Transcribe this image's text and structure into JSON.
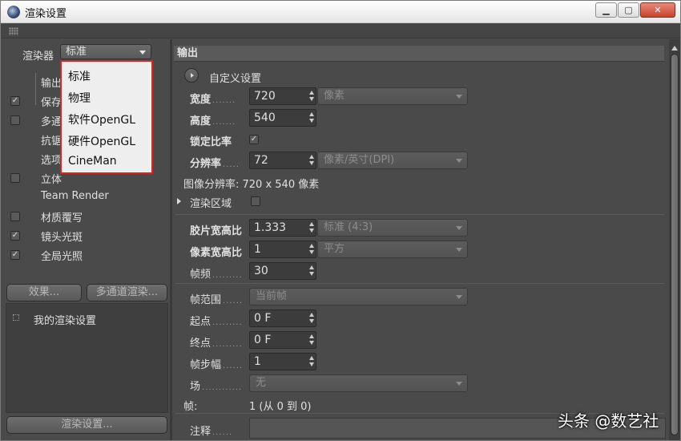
{
  "window": {
    "title": "渲染设置",
    "minimize": "▁",
    "restore": "▢",
    "close": "✕"
  },
  "left": {
    "renderer_label": "渲染器",
    "renderer_value": "标准",
    "nav_items": [
      {
        "label": "输出",
        "checked": null
      },
      {
        "label": "保存",
        "checked": true
      },
      {
        "label": "多通道",
        "checked": false
      },
      {
        "label": "抗锯齿",
        "checked": null
      },
      {
        "label": "选项",
        "checked": null
      },
      {
        "label": "立体",
        "checked": false
      },
      {
        "label": "Team Render",
        "checked": null
      },
      {
        "label": "材质覆写",
        "checked": false
      },
      {
        "label": "镜头光斑",
        "checked": true
      },
      {
        "label": "全局光照",
        "checked": true
      }
    ],
    "effects_button": "效果...",
    "multipass_button": "多通道渲染...",
    "my_settings": "我的渲染设置",
    "render_settings_button": "渲染设置..."
  },
  "dropdown": {
    "options": [
      "标准",
      "物理",
      "软件OpenGL",
      "硬件OpenGL",
      "CineMan"
    ]
  },
  "right": {
    "section_title": "输出",
    "custom_settings": "自定义设置",
    "width_label": "宽度",
    "width_value": "720",
    "width_unit": "像素",
    "height_label": "高度",
    "height_value": "540",
    "lock_ratio_label": "锁定比率",
    "resolution_label": "分辨率",
    "resolution_value": "72",
    "resolution_unit": "像素/英寸(DPI)",
    "image_resolution": "图像分辨率: 720 x 540 像素",
    "render_region_label": "渲染区域",
    "film_aspect_label": "胶片宽高比",
    "film_aspect_value": "1.333",
    "film_aspect_preset": "标准 (4:3)",
    "pixel_aspect_label": "像素宽高比",
    "pixel_aspect_value": "1",
    "pixel_aspect_preset": "平方",
    "fps_label": "帧频",
    "fps_value": "30",
    "frame_range_label": "帧范围",
    "frame_range_value": "当前帧",
    "start_label": "起点",
    "start_value": "0 F",
    "end_label": "终点",
    "end_value": "0 F",
    "frame_step_label": "帧步幅",
    "frame_step_value": "1",
    "fields_label": "场",
    "fields_value": "无",
    "frames_label": "帧:",
    "frames_value": "1 (从 0 到 0)",
    "notes_label": "注释"
  },
  "watermark": "头条 @数艺社"
}
